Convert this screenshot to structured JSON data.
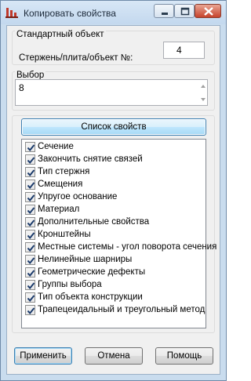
{
  "window": {
    "title": "Копировать свойства",
    "icons": {
      "app": "app-logo-icon",
      "minimize": "minimize-icon",
      "maximize": "maximize-icon",
      "close": "close-icon"
    }
  },
  "standard_object": {
    "group_label": "Стандартный объект",
    "caption": "Стержень/плита/объект №:",
    "value": "4"
  },
  "selection": {
    "group_label": "Выбор",
    "value": "8"
  },
  "properties": {
    "button_label": "Список свойств",
    "items": [
      {
        "label": "Сечение",
        "checked": true
      },
      {
        "label": "Закончить снятие связей",
        "checked": true
      },
      {
        "label": "Тип стержня",
        "checked": true
      },
      {
        "label": "Смещения",
        "checked": true
      },
      {
        "label": "Упругое основание",
        "checked": true
      },
      {
        "label": "Материал",
        "checked": true
      },
      {
        "label": "Дополнительные свойства",
        "checked": true
      },
      {
        "label": "Кронштейны",
        "checked": true
      },
      {
        "label": "Местные системы - угол поворота сечения",
        "checked": true
      },
      {
        "label": "Нелинейные шарниры",
        "checked": true
      },
      {
        "label": "Геометрические дефекты",
        "checked": true
      },
      {
        "label": "Группы выбора",
        "checked": true
      },
      {
        "label": "Тип объекта конструкции",
        "checked": true
      },
      {
        "label": "Трапецеидальный и треугольный метод",
        "checked": true
      }
    ]
  },
  "buttons": {
    "apply": "Применить",
    "cancel": "Отмена",
    "help": "Помощь"
  }
}
